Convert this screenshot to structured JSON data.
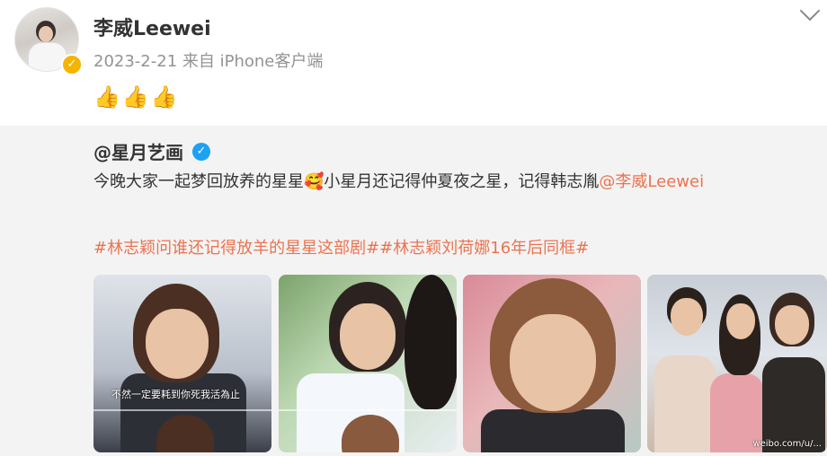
{
  "post": {
    "author": "李威Leewei",
    "meta": "2023-2-21 来自 iPhone客户端",
    "emojis": "👍👍👍"
  },
  "repost": {
    "author": "@星月艺画",
    "text_before": "今晚大家一起梦回放养的星星",
    "emoji": "🥰",
    "text_after": "小星月还记得仲夏夜之星，记得韩志胤",
    "mention": "@李威Leewei",
    "tags": "#林志颖问谁还记得放羊的星星这部剧##林志颖刘荷娜16年后同框#",
    "images": [
      {
        "subtitle": "不然一定要耗到你死我活為止"
      },
      {
        "subtitle": ""
      },
      {
        "subtitle": ""
      },
      {
        "watermark": "weibo.com/u/..."
      }
    ]
  },
  "colors": {
    "accent": "#eb7350",
    "verified_gold": "#f5b400",
    "verified_blue": "#1da1f2",
    "repost_bg": "#f3f3f3"
  }
}
